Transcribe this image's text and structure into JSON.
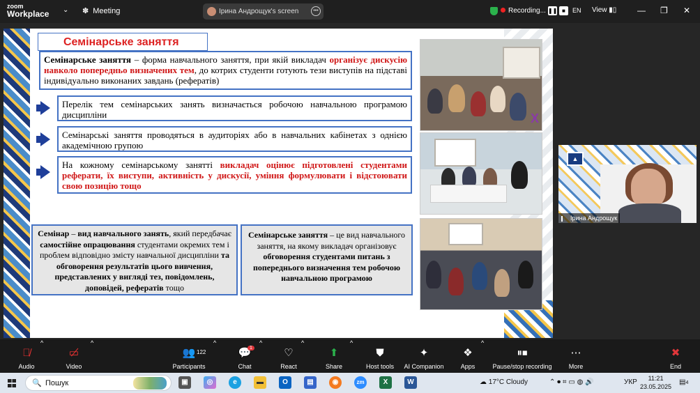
{
  "topbar": {
    "app_line1": "zoom",
    "app_line2": "Workplace",
    "meeting_label": "Meeting",
    "share_label": "Ірина  Андрощук's screen",
    "recording_label": "Recording...",
    "language": "EN",
    "view_label": "View"
  },
  "slide": {
    "title": "Семінарське заняття",
    "definition": {
      "term": "Семінарське заняття",
      "text1": " – форма навчального заняття, при якій викладач ",
      "highlight": "організує дискусію навколо попередньо визначених тем",
      "text2": ", до котрих студенти готують тези виступів на підставі індивідуально виконаних завдань (рефератів)"
    },
    "points": [
      {
        "text": "Перелік тем семінарських занять визначається робочою навчальною програмою дисципліни"
      },
      {
        "text": "Семінарські заняття проводяться в аудиторіях або в навчальних кабінетах з однією академічною групою"
      },
      {
        "pre": "На кожному семінарському занятті ",
        "highlight": "викладач оцінює підготовлені студентами реферати, їх виступи, активність у дискусії, уміння формулювати і відстоювати свою позицію тощо"
      }
    ],
    "box_left": {
      "b1": "Семінар",
      "t1": " – ",
      "b2": "вид навчального занять",
      "t2": ", який передбачає ",
      "b3": "самостійне опрацювання",
      "t3": " студентами окремих тем і проблем відповідно змісту навчальної дисципліни ",
      "b4": "та обговорення результатів цього вивчення, представлених у вигляді тез, повідомлень, доповідей, рефератів",
      "t4": " тощо"
    },
    "box_right": {
      "b1": "Семінарське заняття",
      "t1": " – це вид навчального заняття, на якому викладач організовує ",
      "b2": "обговорення студентами питань з попереднього визначення тем робочою навчальною програмою"
    }
  },
  "video": {
    "participant_name": "Ірина  Андрощук"
  },
  "toolbar": {
    "audio": "Audio",
    "video": "Video",
    "participants": "Participants",
    "participants_count": "122",
    "chat": "Chat",
    "chat_badge": "1",
    "react": "React",
    "share": "Share",
    "host_tools": "Host tools",
    "ai_companion": "AI Companion",
    "apps": "Apps",
    "pause_stop": "Pause/stop recording",
    "more": "More",
    "end": "End"
  },
  "taskbar": {
    "search_placeholder": "Пошук",
    "weather_temp": "17°C",
    "weather_text": "Cloudy",
    "keyboard_lang": "УКР",
    "time": "11:21",
    "date": "23.05.2025",
    "notif_count": "4"
  },
  "colors": {
    "accent_red": "#d01818",
    "slide_blue": "#4472c4",
    "recording_green": "#2bb24c",
    "end_red": "#e0363a"
  }
}
